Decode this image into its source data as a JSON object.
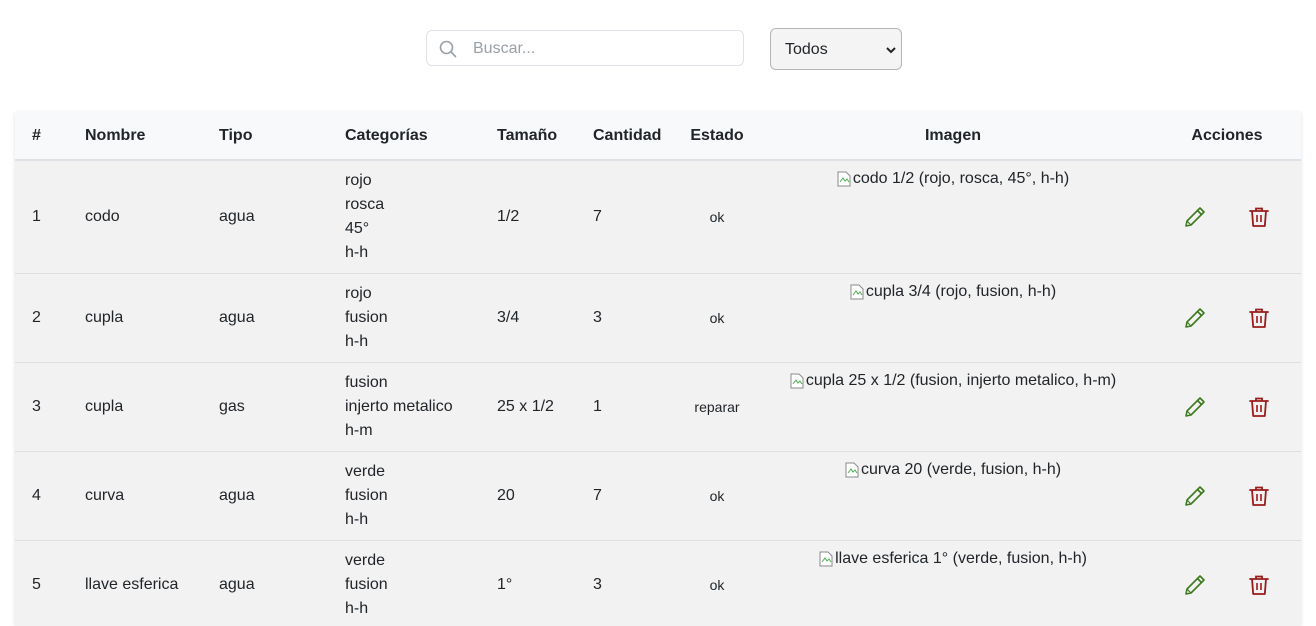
{
  "search": {
    "placeholder": "Buscar..."
  },
  "filter": {
    "selected": "Todos"
  },
  "table": {
    "headers": [
      "#",
      "Nombre",
      "Tipo",
      "Categorías",
      "Tamaño",
      "Cantidad",
      "Estado",
      "Imagen",
      "Acciones"
    ],
    "rows": [
      {
        "num": "1",
        "nombre": "codo",
        "tipo": "agua",
        "categorias": [
          "rojo",
          "rosca",
          "45°",
          "h-h"
        ],
        "tamano": "1/2",
        "cantidad": "7",
        "estado": "ok",
        "imagen": "codo 1/2 (rojo, rosca, 45°, h-h)"
      },
      {
        "num": "2",
        "nombre": "cupla",
        "tipo": "agua",
        "categorias": [
          "rojo",
          "fusion",
          "h-h"
        ],
        "tamano": "3/4",
        "cantidad": "3",
        "estado": "ok",
        "imagen": "cupla 3/4 (rojo, fusion, h-h)"
      },
      {
        "num": "3",
        "nombre": "cupla",
        "tipo": "gas",
        "categorias": [
          "fusion",
          "injerto metalico",
          "h-m"
        ],
        "tamano": "25 x 1/2",
        "cantidad": "1",
        "estado": "reparar",
        "imagen": "cupla 25 x 1/2 (fusion, injerto metalico, h-m)"
      },
      {
        "num": "4",
        "nombre": "curva",
        "tipo": "agua",
        "categorias": [
          "verde",
          "fusion",
          "h-h"
        ],
        "tamano": "20",
        "cantidad": "7",
        "estado": "ok",
        "imagen": "curva 20 (verde, fusion, h-h)"
      },
      {
        "num": "5",
        "nombre": "llave esferica",
        "tipo": "agua",
        "categorias": [
          "verde",
          "fusion",
          "h-h"
        ],
        "tamano": "1°",
        "cantidad": "3",
        "estado": "ok",
        "imagen": "llave esferica 1° (verde, fusion, h-h)"
      }
    ]
  },
  "icons": {
    "search": "search-icon",
    "edit": "pencil-icon",
    "delete": "trash-icon",
    "select_caret": "chevron-down-icon"
  },
  "colors": {
    "edit": "#3d7a1e",
    "delete": "#9b1c1c",
    "row_bg": "#f2f2f2",
    "header_bg": "#f8f9fa"
  }
}
